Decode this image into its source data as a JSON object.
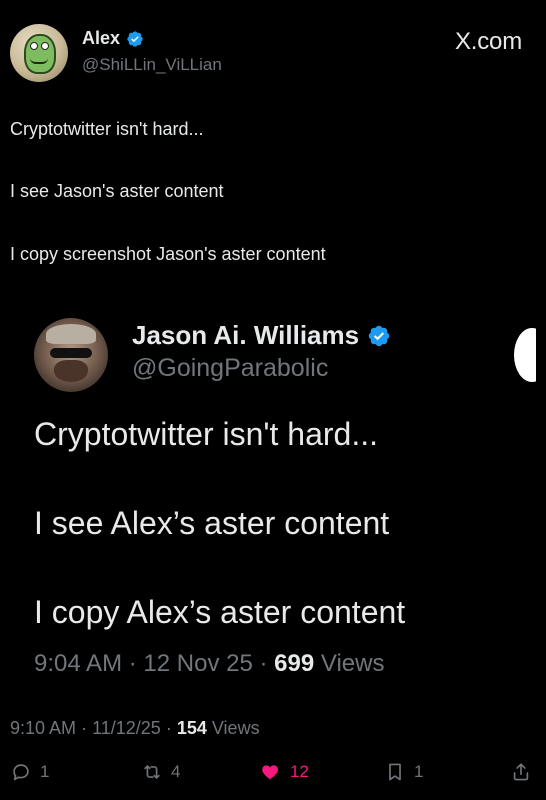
{
  "header": {
    "display_name": "Alex",
    "handle": "@ShiLLin_ViLLian",
    "brand": "X.com"
  },
  "post": {
    "lines": [
      "Cryptotwitter isn't hard...",
      "I see Jason's aster content",
      "I copy screenshot Jason's aster content"
    ],
    "meta": {
      "time": "9:10 AM",
      "date": "11/12/25",
      "views_count": "154",
      "views_label": "Views"
    }
  },
  "embed": {
    "display_name": "Jason Ai. Williams",
    "handle": "@GoingParabolic",
    "lines": [
      "Cryptotwitter isn't hard...",
      "I see Alex’s aster content",
      "I copy Alex’s aster content"
    ],
    "meta": {
      "time": "9:04 AM",
      "date": "12 Nov 25",
      "views_count": "699",
      "views_label": "Views"
    }
  },
  "actions": {
    "reply_count": "1",
    "repost_count": "4",
    "like_count": "12",
    "bookmark_count": "1"
  },
  "colors": {
    "background": "#000000",
    "text": "#e7e9ea",
    "muted": "#71767b",
    "accent_blue": "#1d9bf0",
    "like_pink": "#f91880"
  },
  "icons": {
    "verified": "verified-badge-icon",
    "reply": "reply-icon",
    "repost": "repost-icon",
    "like": "heart-icon",
    "bookmark": "bookmark-icon",
    "share": "share-icon"
  }
}
